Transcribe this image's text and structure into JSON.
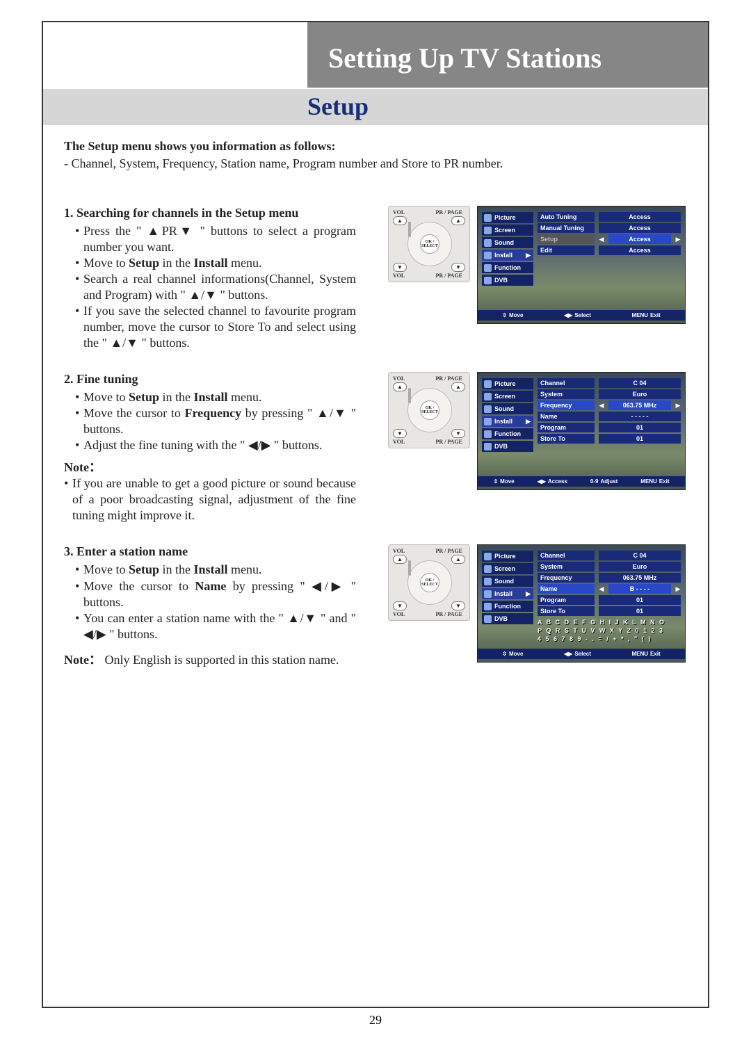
{
  "page_number": "29",
  "header_title": "Setting Up TV Stations",
  "subheader": "Setup",
  "intro_bold": "The Setup menu shows you information as follows:",
  "intro_text": "- Channel, System, Frequency, Station name, Program number and Store to PR number.",
  "remote": {
    "vol": "VOL",
    "pr": "PR / PAGE",
    "ok": "OK / SELECT"
  },
  "section1": {
    "heading": "1. Searching for channels in the Setup menu",
    "b1": "Press the \" ▲PR▼ \" buttons to select a program number you want.",
    "b2_pre": "Move to ",
    "b2_bold1": "Setup",
    "b2_mid": " in the ",
    "b2_bold2": "Install",
    "b2_post": " menu.",
    "b3": "Search a real channel informations(Channel, System and Program) with \" ▲/▼ \" buttons.",
    "b4": "If you save the selected channel to favourite program number, move the cursor to Store To and select using the \" ▲/▼ \" buttons.",
    "osd": {
      "menu": [
        "Picture",
        "Screen",
        "Sound",
        "Install",
        "Function",
        "DVB"
      ],
      "sel_index": 3,
      "rows": [
        {
          "l": "Auto Tuning",
          "v": "Access"
        },
        {
          "l": "Manual Tuning",
          "v": "Access"
        },
        {
          "l": "Setup",
          "v": "Access",
          "hl": true,
          "dim": true
        },
        {
          "l": "Edit",
          "v": "Access"
        }
      ],
      "footer": [
        {
          "ico": "⇳",
          "t": "Move"
        },
        {
          "ico": "◀▶",
          "t": "Select"
        },
        {
          "ico": "MENU",
          "t": "Exit"
        }
      ]
    }
  },
  "section2": {
    "heading": "2. Fine tuning",
    "b1_pre": "Move to ",
    "b1_bold1": "Setup",
    "b1_mid": " in the ",
    "b1_bold2": "Install",
    "b1_post": " menu.",
    "b2_pre": "Move the cursor to ",
    "b2_bold": "Frequency",
    "b2_post": " by pressing \" ▲/▼ \" buttons.",
    "b3": "Adjust the fine tuning with the \" ◀/▶ \" buttons.",
    "note_label": "Note：",
    "note_text": "If you are unable to get a good picture or sound because of a poor broadcasting signal, adjustment of the fine tuning might improve it.",
    "osd": {
      "menu": [
        "Picture",
        "Screen",
        "Sound",
        "Install",
        "Function",
        "DVB"
      ],
      "sel_index": 3,
      "rows": [
        {
          "l": "Channel",
          "v": "C 04"
        },
        {
          "l": "System",
          "v": "Euro"
        },
        {
          "l": "Frequency",
          "v": "063.75 MHz",
          "hl": true
        },
        {
          "l": "Name",
          "v": "- - - - -"
        },
        {
          "l": "Program",
          "v": "01"
        },
        {
          "l": "Store To",
          "v": "01"
        }
      ],
      "footer": [
        {
          "ico": "⇳",
          "t": "Move"
        },
        {
          "ico": "◀▶",
          "t": "Access"
        },
        {
          "ico": "0-9",
          "t": "Adjust"
        },
        {
          "ico": "MENU",
          "t": "Exit"
        }
      ]
    }
  },
  "section3": {
    "heading": "3. Enter a station name",
    "b1_pre": "Move to ",
    "b1_bold1": "Setup",
    "b1_mid": " in the ",
    "b1_bold2": "Install",
    "b1_post": " menu.",
    "b2_pre": "Move the cursor to ",
    "b2_bold": "Name",
    "b2_post": " by pressing \" ◀/▶ \" buttons.",
    "b3": "You can enter a station name with the \" ▲/▼ \" and \" ◀/▶ \" buttons.",
    "note_label": "Note：",
    "note_text": "Only English is supported in this station name.",
    "osd": {
      "menu": [
        "Picture",
        "Screen",
        "Sound",
        "Install",
        "Function",
        "DVB"
      ],
      "sel_index": 3,
      "rows": [
        {
          "l": "Channel",
          "v": "C 04"
        },
        {
          "l": "System",
          "v": "Euro"
        },
        {
          "l": "Frequency",
          "v": "063.75 MHz"
        },
        {
          "l": "Name",
          "v": "B - - - -",
          "hl": true
        },
        {
          "l": "Program",
          "v": "01"
        },
        {
          "l": "Store To",
          "v": "01"
        }
      ],
      "charset1": "A B C D E F G H I J K L M N O",
      "charset2": "P Q R S T U V W X Y Z 0 1 2 3",
      "charset3": "4 5 6 7 8 9 - . = / + * , \" ( )",
      "footer": [
        {
          "ico": "⇳",
          "t": "Move"
        },
        {
          "ico": "◀▶",
          "t": "Select"
        },
        {
          "ico": "MENU",
          "t": "Exit"
        }
      ]
    }
  }
}
